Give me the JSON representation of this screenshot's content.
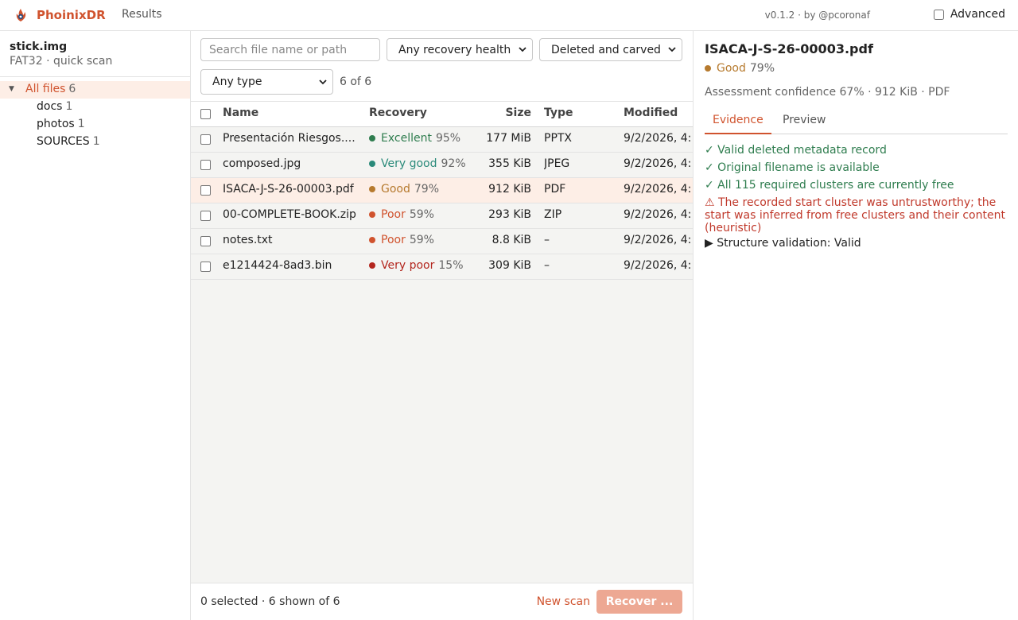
{
  "app": {
    "name": "PhoinixDR",
    "nav_results": "Results",
    "version": "v0.1.2 · by @pcoronaf",
    "advanced_label": "Advanced"
  },
  "colors": {
    "accent": "#d0532e",
    "excellent": "#2f7d4f",
    "very_good": "#2a8a7a",
    "good": "#b67a2e",
    "poor": "#d0532e",
    "very_poor": "#b3261e"
  },
  "sidebar": {
    "image_name": "stick.img",
    "image_sub": "FAT32 · quick scan",
    "tree": [
      {
        "label": "All files",
        "count": "6"
      },
      {
        "label": "docs",
        "count": "1"
      },
      {
        "label": "photos",
        "count": "1"
      },
      {
        "label": "SOURCES",
        "count": "1"
      }
    ]
  },
  "filters": {
    "search_placeholder": "Search file name or path",
    "health_selected": "Any recovery health",
    "kind_selected": "Deleted and carved",
    "type_selected": "Any type",
    "count_text": "6 of 6"
  },
  "table": {
    "headers": {
      "name": "Name",
      "recovery": "Recovery",
      "size": "Size",
      "type": "Type",
      "modified": "Modified"
    },
    "rows": [
      {
        "name": "Presentación Riesgos....",
        "health": "Excellent",
        "pct": "95%",
        "color": "#2f7d4f",
        "size": "177 MiB",
        "type": "PPTX",
        "modified": "9/2/2026, 4:"
      },
      {
        "name": "composed.jpg",
        "health": "Very good",
        "pct": "92%",
        "color": "#2a8a7a",
        "size": "355 KiB",
        "type": "JPEG",
        "modified": "9/2/2026, 4:"
      },
      {
        "name": "ISACA-J-S-26-00003.pdf",
        "health": "Good",
        "pct": "79%",
        "color": "#b67a2e",
        "size": "912 KiB",
        "type": "PDF",
        "modified": "9/2/2026, 4:"
      },
      {
        "name": "00-COMPLETE-BOOK.zip",
        "health": "Poor",
        "pct": "59%",
        "color": "#d0532e",
        "size": "293 KiB",
        "type": "ZIP",
        "modified": "9/2/2026, 4:"
      },
      {
        "name": "notes.txt",
        "health": "Poor",
        "pct": "59%",
        "color": "#d0532e",
        "size": "8.8 KiB",
        "type": "–",
        "modified": "9/2/2026, 4:"
      },
      {
        "name": "e1214424-8ad3.bin",
        "health": "Very poor",
        "pct": "15%",
        "color": "#b3261e",
        "size": "309 KiB",
        "type": "–",
        "modified": "9/2/2026, 4:"
      }
    ]
  },
  "footer": {
    "selection_status": "0 selected · 6 shown of 6",
    "new_scan": "New scan",
    "recover": "Recover ..."
  },
  "detail": {
    "title": "ISACA-J-S-26-00003.pdf",
    "health": "Good",
    "pct": "79%",
    "meta": "Assessment confidence 67% · 912 KiB · PDF",
    "tabs": [
      "Evidence",
      "Preview"
    ],
    "evidence": [
      {
        "kind": "ok",
        "text": "✓ Valid deleted metadata record"
      },
      {
        "kind": "ok",
        "text": "✓ Original filename is available"
      },
      {
        "kind": "ok",
        "text": "✓ All 115 required clusters are currently free"
      },
      {
        "kind": "warn",
        "text": "⚠ The recorded start cluster was untrustworthy; the start was inferred from free clusters and their content (heuristic)"
      },
      {
        "kind": "info",
        "text": "▶ Structure validation: Valid"
      }
    ]
  }
}
